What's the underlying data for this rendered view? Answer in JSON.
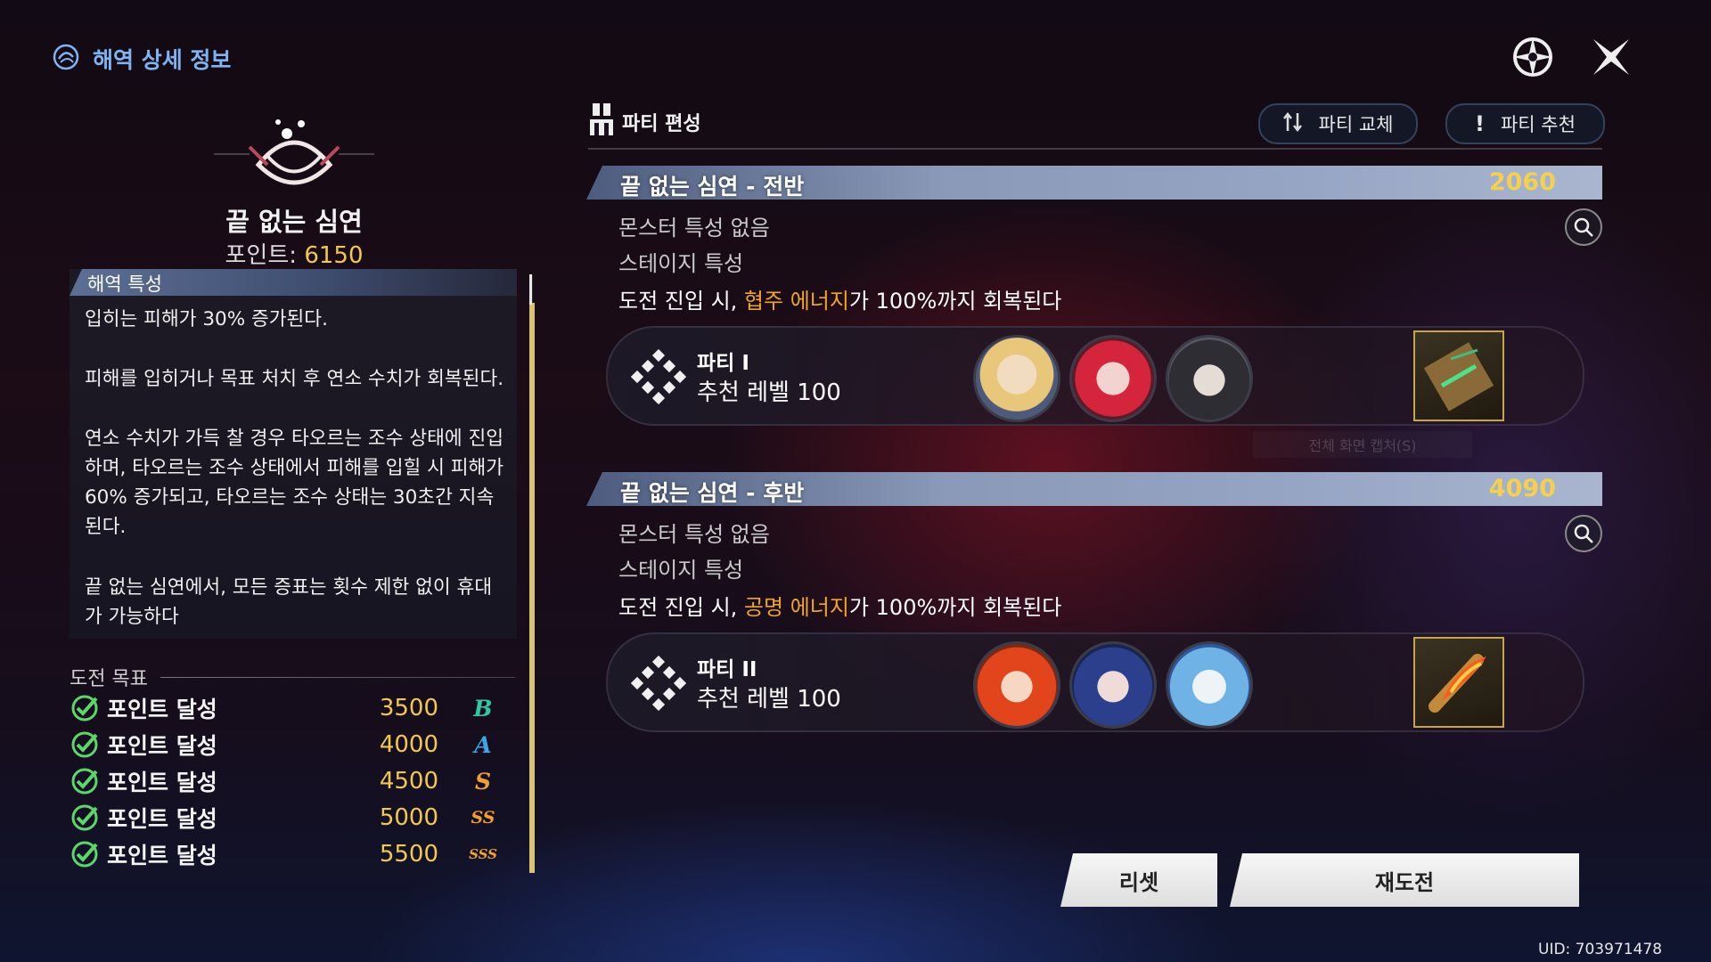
{
  "header": {
    "title": "해역 상세 정보"
  },
  "sea_area": {
    "name": "끝 없는 심연",
    "points_label": "포인트: ",
    "points_value": "6150",
    "traits_title": "해역 특성",
    "traits": [
      "입히는 피해가 30% 증가된다.",
      "피해를 입히거나 목표 처치 후 연소 수치가 회복된다.",
      "연소 수치가 가득 찰 경우 타오르는 조수 상태에 진입하며, 타오르는 조수 상태에서 피해를 입힐 시 피해가 60% 증가되고, 타오르는 조수 상태는 30초간 지속된다.",
      "끝 없는 심연에서, 모든 증표는 횟수 제한 없이 휴대가 가능하다"
    ]
  },
  "challenge": {
    "title": "도전 목표",
    "goals": [
      {
        "label": "포인트 달성",
        "points": "3500",
        "rank": "B",
        "rank_color": "#2fc8a2",
        "done": true
      },
      {
        "label": "포인트 달성",
        "points": "4000",
        "rank": "A",
        "rank_color": "#3aa7e6",
        "done": true
      },
      {
        "label": "포인트 달성",
        "points": "4500",
        "rank": "S",
        "rank_color": "#f0a030",
        "done": true
      },
      {
        "label": "포인트 달성",
        "points": "5000",
        "rank": "SS",
        "rank_color": "#f0a030",
        "done": true
      },
      {
        "label": "포인트 달성",
        "points": "5500",
        "rank": "SSS",
        "rank_color": "#f0a030",
        "done": true
      }
    ]
  },
  "party_edit": {
    "title": "파티 편성",
    "swap_button": "파티 교체",
    "recommend_button": "파티 추천"
  },
  "stages": [
    {
      "name": "끝 없는 심연 - 전반",
      "score": "2060",
      "monster_trait": "몬스터 특성 없음",
      "stage_trait_title": "스테이지 특성",
      "desc_pre": "도전 진입 시, ",
      "desc_hl": "협주 에너지",
      "desc_post": "가 100%까지 회복된다",
      "party_name": "파티 I",
      "party_level": "추천 레벨 100",
      "avatars": [
        "avatar-blonde-crown",
        "avatar-red-horns",
        "avatar-dark-hair"
      ],
      "item": "rune-tablet-icon"
    },
    {
      "name": "끝 없는 심연 - 후반",
      "score": "4090",
      "monster_trait": "몬스터 특성 없음",
      "stage_trait_title": "스테이지 특성",
      "desc_pre": "도전 진입 시, ",
      "desc_hl": "공명 에너지",
      "desc_post": "가 100%까지 회복된다",
      "party_name": "파티 II",
      "party_level": "추천 레벨 100",
      "avatars": [
        "avatar-orange-hair",
        "avatar-blue-hair",
        "avatar-white-hair"
      ],
      "item": "flame-scroll-icon"
    }
  ],
  "buttons": {
    "reset": "리셋",
    "retry": "재도전"
  },
  "uid": "UID: 703971478",
  "watermark": "전체 화면 캡처(S)",
  "colors": {
    "accent_gold": "#f2c84b",
    "highlight_orange": "#f0a429",
    "title_blue": "#7fb4f2"
  }
}
